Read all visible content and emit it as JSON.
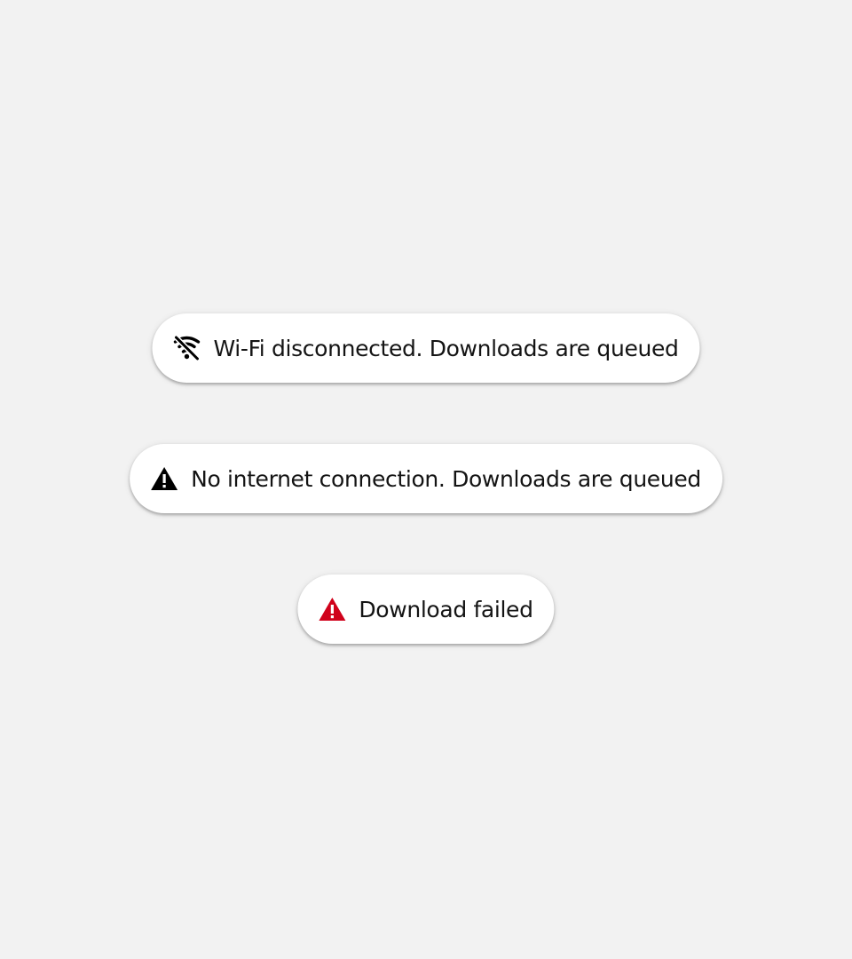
{
  "toasts": [
    {
      "message": "Wi-Fi disconnected. Downloads are queued",
      "icon": "wifi-off-icon",
      "icon_color": "#000000"
    },
    {
      "message": "No internet connection. Downloads are queued",
      "icon": "warning-icon",
      "icon_color": "#000000"
    },
    {
      "message": "Download failed",
      "icon": "warning-icon",
      "icon_color": "#d0021b"
    }
  ],
  "colors": {
    "background": "#f2f2f2",
    "toast_background": "#ffffff",
    "text": "#141414",
    "error": "#d0021b"
  }
}
